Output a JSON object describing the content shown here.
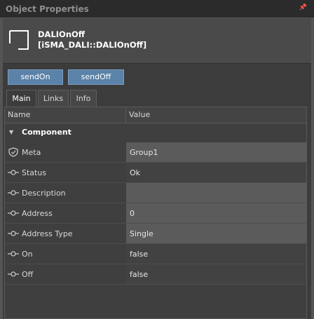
{
  "panel": {
    "title": "Object Properties",
    "pin_icon": "pin-icon"
  },
  "component": {
    "name": "DALIOnOff",
    "type": "[iSMA_DALI::DALIOnOff]",
    "icon": "component-square-icon"
  },
  "actions": [
    {
      "label": "sendOn"
    },
    {
      "label": "sendOff"
    }
  ],
  "tabs": [
    {
      "label": "Main",
      "active": true
    },
    {
      "label": "Links",
      "active": false
    },
    {
      "label": "Info",
      "active": false
    }
  ],
  "table": {
    "col_name": "Name",
    "col_value": "Value",
    "group": "Component",
    "rows": [
      {
        "name": "Meta",
        "value": "Group1",
        "icon": "shield-icon"
      },
      {
        "name": "Status",
        "value": "Ok",
        "icon": "slot-icon"
      },
      {
        "name": "Description",
        "value": "",
        "icon": "slot-icon"
      },
      {
        "name": "Address",
        "value": "0",
        "icon": "slot-icon"
      },
      {
        "name": "Address Type",
        "value": "Single",
        "icon": "slot-icon"
      },
      {
        "name": "On",
        "value": "false",
        "icon": "slot-icon"
      },
      {
        "name": "Off",
        "value": "false",
        "icon": "slot-icon"
      }
    ]
  },
  "colors": {
    "accent_button": "#5b82a8",
    "panel_bg": "#3c3c3c"
  }
}
